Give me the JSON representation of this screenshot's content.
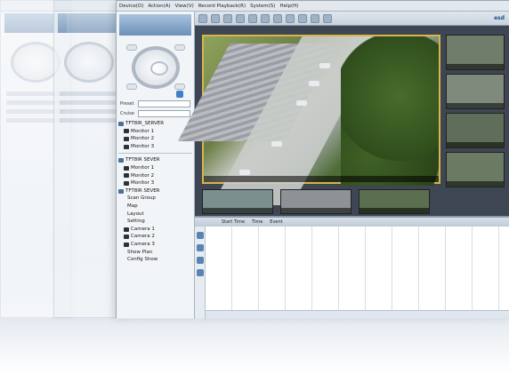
{
  "menu": [
    "Device(D)",
    "Action(A)",
    "View(V)",
    "Record Playback(R)",
    "System(S)",
    "Help(H)"
  ],
  "left_panel": {
    "preset_label": "Preset",
    "cruise_label": "Cruise",
    "tree": [
      {
        "label": "TFT8IR_SERVER",
        "type": "server"
      },
      {
        "label": "Monitor 1",
        "type": "monitor"
      },
      {
        "label": "Monitor 2",
        "type": "monitor"
      },
      {
        "label": "Monitor 3",
        "type": "monitor"
      },
      {
        "label": "TFT8IR SEVER",
        "type": "server"
      },
      {
        "label": "Monitor 1",
        "type": "monitor"
      },
      {
        "label": "Monitor 2",
        "type": "monitor"
      },
      {
        "label": "Monitor 3",
        "type": "monitor"
      },
      {
        "label": "TFT8IR SEVER",
        "type": "server"
      },
      {
        "label": "Scan Group",
        "type": "item"
      },
      {
        "label": "Map",
        "type": "item"
      },
      {
        "label": "Layout",
        "type": "item"
      },
      {
        "label": "Setting",
        "type": "item"
      },
      {
        "label": "Camera 1",
        "type": "camera"
      },
      {
        "label": "Camera 2",
        "type": "camera"
      },
      {
        "label": "Camera 3",
        "type": "camera"
      },
      {
        "label": "Show Plan",
        "type": "item"
      },
      {
        "label": "Config Show",
        "type": "item"
      }
    ]
  },
  "toolbar": {
    "logo": "esd"
  },
  "timeline": {
    "columns": [
      "Start Time",
      "Time",
      "Event"
    ]
  }
}
